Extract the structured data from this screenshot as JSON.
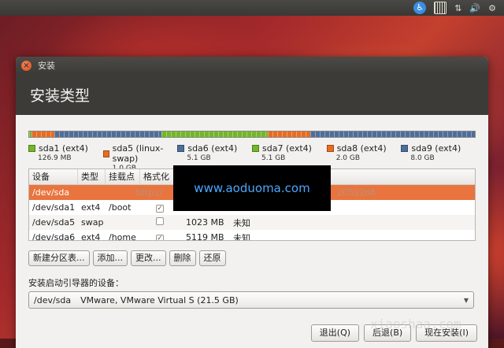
{
  "topbar": {
    "icons": [
      "accessibility-icon",
      "keyboard-icon",
      "network-icon",
      "volume-icon",
      "power-icon"
    ]
  },
  "window": {
    "title": "安装",
    "header": "安装类型"
  },
  "partitions": [
    {
      "name": "sda1 (ext4)",
      "size": "126.9 MB",
      "color": "#73b628",
      "share": 0.006
    },
    {
      "name": "sda5 (linux-swap)",
      "size": "1.0 GB",
      "color": "#e86c20",
      "share": 0.05
    },
    {
      "name": "sda6 (ext4)",
      "size": "5.1 GB",
      "color": "#4e6e9a",
      "share": 0.24
    },
    {
      "name": "sda7 (ext4)",
      "size": "5.1 GB",
      "color": "#73b628",
      "share": 0.24
    },
    {
      "name": "sda8 (ext4)",
      "size": "2.0 GB",
      "color": "#e86c20",
      "share": 0.094
    },
    {
      "name": "sda9 (ext4)",
      "size": "8.0 GB",
      "color": "#4e6e9a",
      "share": 0.37
    }
  ],
  "table": {
    "headers": [
      "设备",
      "类型",
      "挂载点",
      "格式化"
    ],
    "rows": [
      {
        "device": "/dev/sda",
        "type": "",
        "mount": "",
        "format": null,
        "size": "",
        "used": ""
      },
      {
        "device": "/dev/sda1",
        "type": "ext4",
        "mount": "/boot",
        "format": true,
        "size": "",
        "used": ""
      },
      {
        "device": "/dev/sda5",
        "type": "swap",
        "mount": "",
        "format": false,
        "size": "1023 MB",
        "used": "未知"
      },
      {
        "device": "/dev/sda6",
        "type": "ext4",
        "mount": "/home",
        "format": true,
        "size": "5119 MB",
        "used": "未知"
      }
    ]
  },
  "watermark": {
    "site": "www.aoduoma.com",
    "faint_left": "http://",
    "faint_right": "2052268"
  },
  "actions": {
    "new_table": "新建分区表...",
    "add": "添加...",
    "change": "更改...",
    "delete": "删除",
    "revert": "还原"
  },
  "boot": {
    "label": "安装启动引导器的设备：",
    "device": "/dev/sda",
    "description": "VMware, VMware Virtual S (21.5 GB)"
  },
  "footer": {
    "quit": "退出(Q)",
    "back": "后退(B)",
    "install_now": "现在安装(I)"
  },
  "site_watermark": "xiaoshaa.com"
}
